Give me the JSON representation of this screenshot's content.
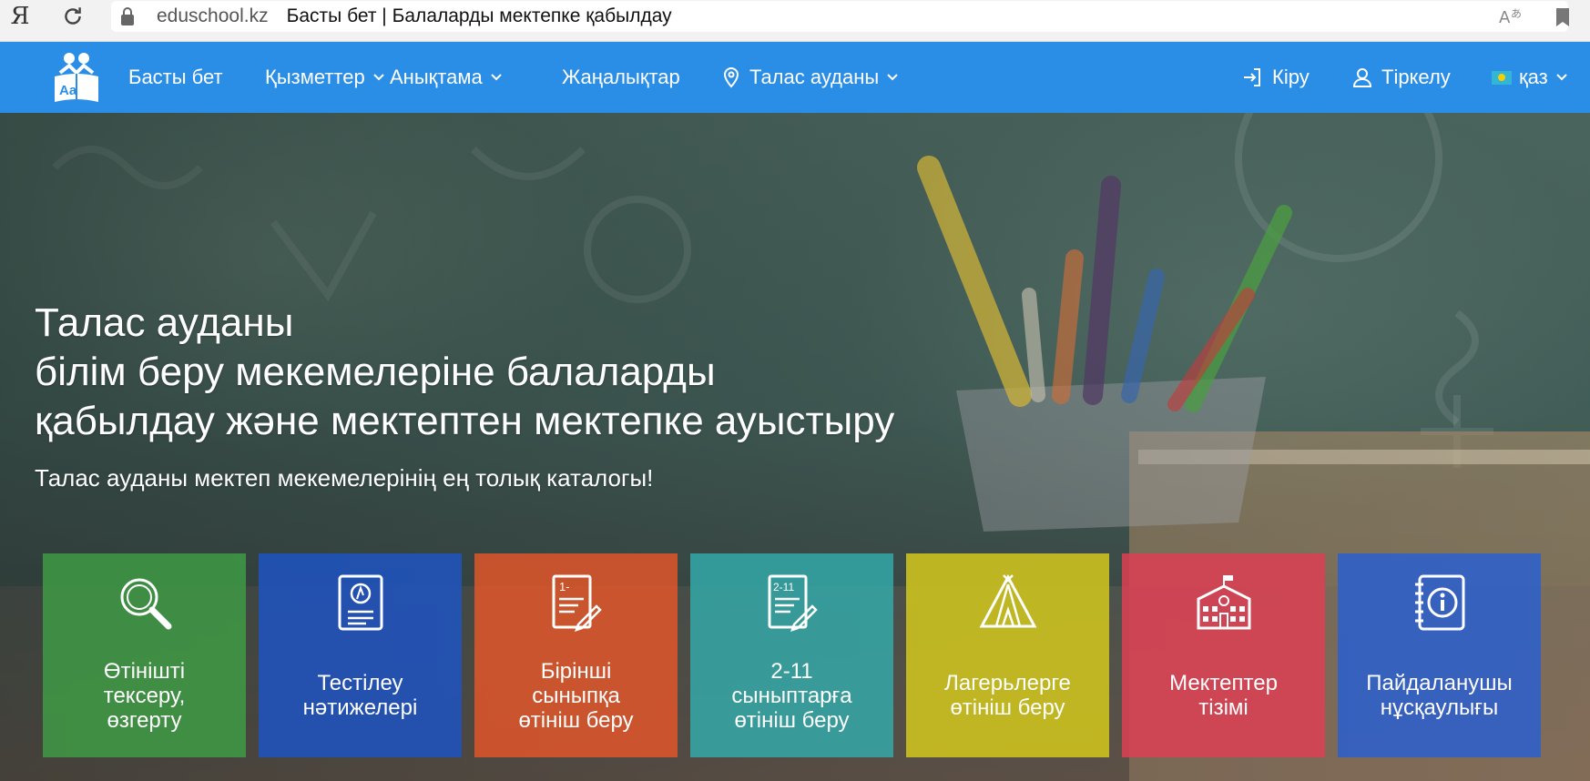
{
  "browser": {
    "ya_logo": "Я",
    "domain": "eduschool.kz",
    "page_title": "Басты бет | Балаларды мектепке қабылдау"
  },
  "nav": {
    "items": [
      {
        "label": "Басты бет"
      },
      {
        "label": "Қызметтер"
      },
      {
        "label": "Анықтама"
      },
      {
        "label": "Жаңалықтар"
      },
      {
        "label": "Талас ауданы"
      }
    ],
    "login": "Кіру",
    "register": "Тіркелу",
    "language": "қаз",
    "color": "#2b8ee6"
  },
  "hero": {
    "title_lines": [
      "Талас ауданы",
      "білім беру мекемелеріне балаларды",
      "қабылдау және мектептен мектепке ауыстыру"
    ],
    "subtitle": "Талас ауданы мектеп мекемелерінің ең толық каталогы!"
  },
  "tiles": [
    {
      "label": "Өтінішті\nтексеру,\nөзгерту",
      "icon": "magnifier-icon",
      "color": "#3f9a45"
    },
    {
      "label": "Тестілеу\nнәтижелері",
      "icon": "test-sheet-icon",
      "color": "#1f54c2"
    },
    {
      "label": "Бірінші\nсыныпқа\nөтініш беру",
      "icon": "first-grade-application-icon",
      "color": "#e0562a"
    },
    {
      "label": "2-11\nсыныптарға\nөтініш беру",
      "icon": "grades-application-icon",
      "color": "#34a8a8"
    },
    {
      "label": "Лагерьлерге\nөтініш беру",
      "icon": "tent-icon",
      "color": "#cfc41e"
    },
    {
      "label": "Мектептер\nтізімі",
      "icon": "school-building-icon",
      "color": "#dd3f54"
    },
    {
      "label": "Пайдаланушы\nнұсқаулығы",
      "icon": "info-icon",
      "color": "#2a5fcf"
    }
  ]
}
